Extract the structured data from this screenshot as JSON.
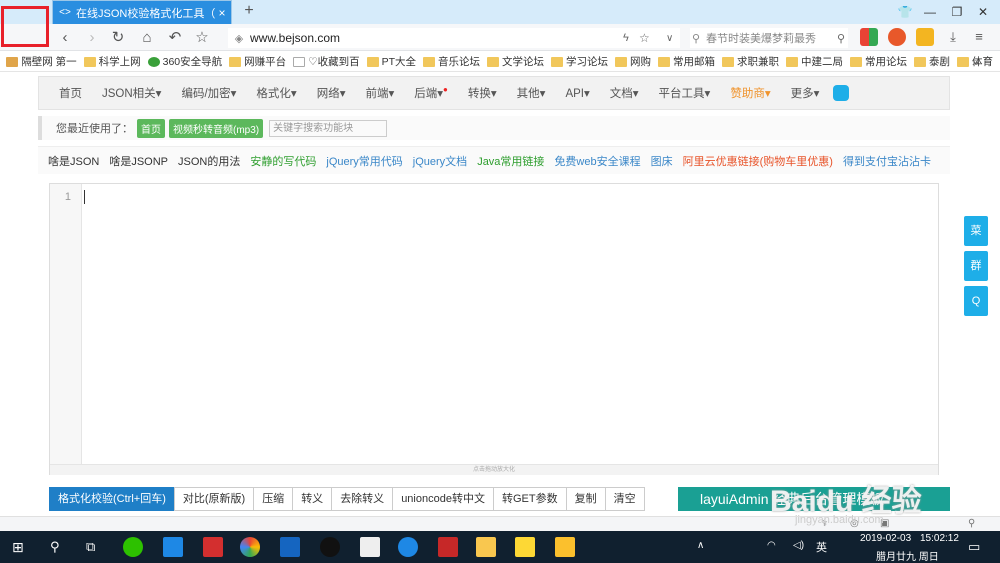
{
  "browser": {
    "tab_title": "在线JSON校验格式化工具（Be",
    "tab_close": "×",
    "new_tab": "+",
    "url": "www.bejson.com",
    "search_placeholder": "春节时装美爆梦莉最秀",
    "window_controls": [
      "—",
      "❐",
      "✕"
    ]
  },
  "bookmarks": [
    "隔壁网 第一",
    "科学上网",
    "360安全导航",
    "网赚平台",
    "♡收藏到百",
    "PT大全",
    "音乐论坛",
    "文学论坛",
    "学习论坛",
    "网购",
    "常用邮箱",
    "求职兼职",
    "中建二局",
    "常用论坛",
    "泰剧",
    "体育"
  ],
  "bookmarks_more": "»",
  "menu": [
    {
      "label": "首页",
      "color": "#555"
    },
    {
      "label": "JSON相关▾",
      "color": "#555"
    },
    {
      "label": "编码/加密▾",
      "color": "#555"
    },
    {
      "label": "格式化▾",
      "color": "#555"
    },
    {
      "label": "网络▾",
      "color": "#555"
    },
    {
      "label": "前端▾",
      "color": "#555"
    },
    {
      "label": "后端▾",
      "color": "#555"
    },
    {
      "label": "转换▾",
      "color": "#555"
    },
    {
      "label": "其他▾",
      "color": "#555"
    },
    {
      "label": "API▾",
      "color": "#555"
    },
    {
      "label": "文档▾",
      "color": "#555"
    },
    {
      "label": "平台工具▾",
      "color": "#555"
    },
    {
      "label": "赞助商▾",
      "color": "#f0932b"
    },
    {
      "label": "更多▾",
      "color": "#555"
    }
  ],
  "recent": {
    "label": "您最近使用了：",
    "items": [
      "首页",
      "视频秒转音频(mp3)"
    ],
    "keyword_placeholder": "关键字搜索功能块"
  },
  "links": [
    {
      "label": "啥是JSON",
      "color": "#333"
    },
    {
      "label": "啥是JSONP",
      "color": "#333"
    },
    {
      "label": "JSON的用法",
      "color": "#333"
    },
    {
      "label": "安静的写代码",
      "color": "#2e9e2e"
    },
    {
      "label": "jQuery常用代码",
      "color": "#3a87c8"
    },
    {
      "label": "jQuery文档",
      "color": "#3a87c8"
    },
    {
      "label": "Java常用链接",
      "color": "#2e9e2e"
    },
    {
      "label": "免费web安全课程",
      "color": "#3a87c8"
    },
    {
      "label": "图床",
      "color": "#3a87c8"
    },
    {
      "label": "阿里云优惠链接(购物车里优惠)",
      "color": "#e8542a"
    },
    {
      "label": "得到支付宝沾沾卡",
      "color": "#3a87c8"
    }
  ],
  "editor": {
    "line_number": "1",
    "resize_hint": "点击拖动放大化"
  },
  "actions": [
    "格式化校验(Ctrl+回车)",
    "对比(原新版)",
    "压缩",
    "转义",
    "去除转义",
    "unioncode转中文",
    "转GET参数",
    "复制",
    "清空"
  ],
  "layui_banner": "layuiAdmin 经典后台管理模板",
  "side_buttons": [
    "菜",
    "群",
    "Q"
  ],
  "watermark": "Baidu 经验",
  "watermark_sub": "jingyan.baidu.com",
  "taskbar": {
    "lang": "英",
    "date": "2019-02-03",
    "time": "15:02:12",
    "lunar": "腊月廿九 周日"
  }
}
